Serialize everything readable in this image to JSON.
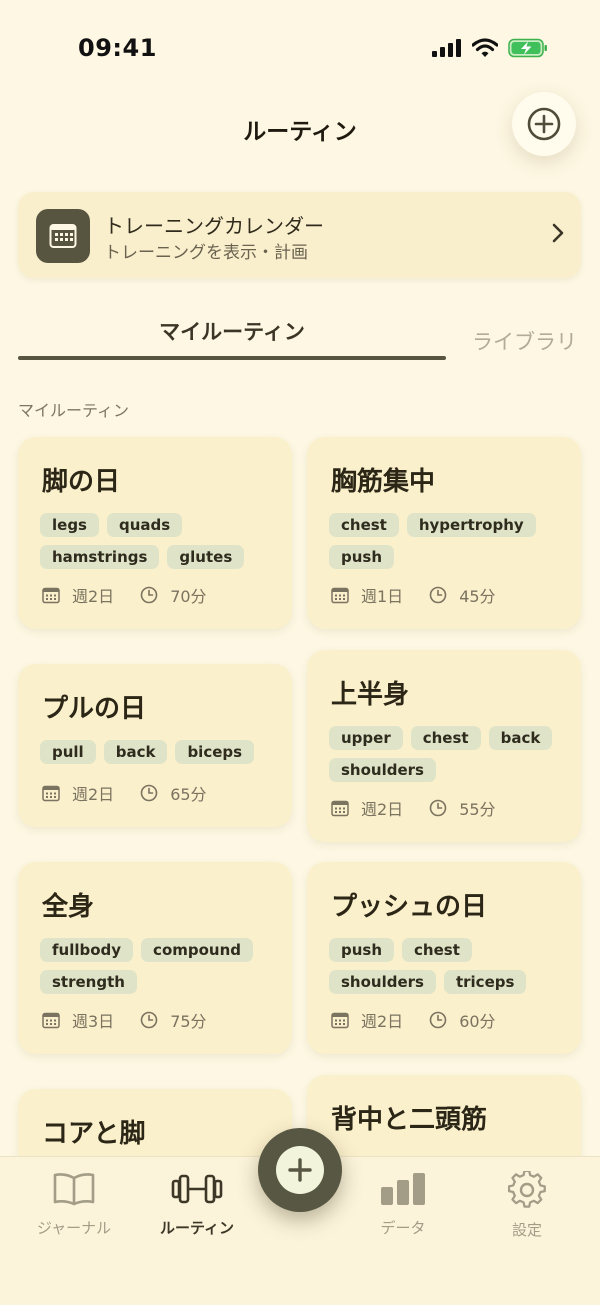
{
  "status": {
    "time": "09:41"
  },
  "header": {
    "title": "ルーティン"
  },
  "calendar": {
    "title": "トレーニングカレンダー",
    "subtitle": "トレーニングを表示・計画"
  },
  "tabs": {
    "my": "マイルーティン",
    "library": "ライブラリ"
  },
  "section_label": "マイルーティン",
  "routines": [
    {
      "title": "脚の日",
      "tags": [
        "legs",
        "quads",
        "hamstrings",
        "glutes"
      ],
      "frequency": "週2日",
      "duration": "70分"
    },
    {
      "title": "胸筋集中",
      "tags": [
        "chest",
        "hypertrophy",
        "push"
      ],
      "frequency": "週1日",
      "duration": "45分"
    },
    {
      "title": "プルの日",
      "tags": [
        "pull",
        "back",
        "biceps"
      ],
      "frequency": "週2日",
      "duration": "65分"
    },
    {
      "title": "上半身",
      "tags": [
        "upper",
        "chest",
        "back",
        "shoulders"
      ],
      "frequency": "週2日",
      "duration": "55分"
    },
    {
      "title": "全身",
      "tags": [
        "fullbody",
        "compound",
        "strength"
      ],
      "frequency": "週3日",
      "duration": "75分"
    },
    {
      "title": "プッシュの日",
      "tags": [
        "push",
        "chest",
        "shoulders",
        "triceps"
      ],
      "frequency": "週2日",
      "duration": "60分"
    },
    {
      "title": "コアと脚"
    },
    {
      "title": "背中と二頭筋"
    }
  ],
  "tab_bar": {
    "journal": "ジャーナル",
    "routines": "ルーティン",
    "data": "データ",
    "settings": "設定"
  }
}
